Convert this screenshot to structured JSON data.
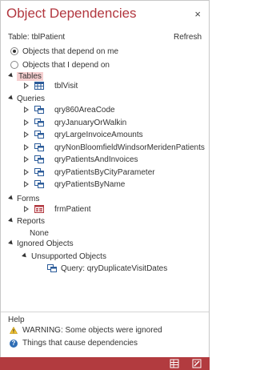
{
  "pane": {
    "title": "Object Dependencies",
    "close_icon": "×",
    "subheader": "Table: tblPatient",
    "refresh_label": "Refresh"
  },
  "options": {
    "depend_on_me": "Objects that depend on me",
    "i_depend_on": "Objects that I depend on",
    "selected": "depend_on_me"
  },
  "tree": {
    "tables": {
      "label": "Tables",
      "items": [
        "tblVisit"
      ]
    },
    "queries": {
      "label": "Queries",
      "items": [
        "qry860AreaCode",
        "qryJanuaryOrWalkin",
        "qryLargeInvoiceAmounts",
        "qryNonBloomfieldWindsorMeridenPatients",
        "qryPatientsAndInvoices",
        "qryPatientsByCityParameter",
        "qryPatientsByName"
      ]
    },
    "forms": {
      "label": "Forms",
      "items": [
        "frmPatient"
      ]
    },
    "reports": {
      "label": "Reports",
      "none": "None"
    },
    "ignored": {
      "label": "Ignored Objects",
      "unsupported_label": "Unsupported Objects",
      "items": [
        "Query: qryDuplicateVisitDates"
      ]
    }
  },
  "help": {
    "label": "Help",
    "warning": "WARNING: Some objects were ignored",
    "link": "Things that cause dependencies"
  },
  "colors": {
    "accent": "#b2373f",
    "statusbar": "#b23b3f",
    "tables_highlight": "#f5cfd0"
  }
}
